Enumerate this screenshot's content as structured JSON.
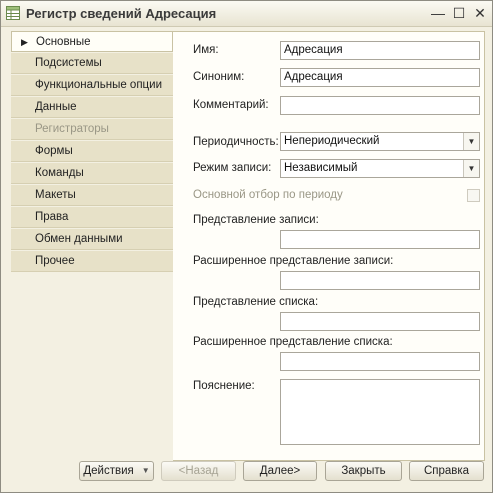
{
  "window": {
    "title": "Регистр сведений Адресация",
    "icon": "table-icon",
    "controls": {
      "minimize": "—",
      "maximize": "☐",
      "close": "✕"
    }
  },
  "nav": {
    "items": [
      {
        "label": "Основные",
        "state": "active"
      },
      {
        "label": "Подсистемы"
      },
      {
        "label": "Функциональные опции"
      },
      {
        "label": "Данные"
      },
      {
        "label": "Регистраторы",
        "state": "disabled"
      },
      {
        "label": "Формы"
      },
      {
        "label": "Команды"
      },
      {
        "label": "Макеты"
      },
      {
        "label": "Права"
      },
      {
        "label": "Обмен данными"
      },
      {
        "label": "Прочее"
      }
    ]
  },
  "form": {
    "name_label": "Имя:",
    "name_value": "Адресация",
    "synonym_label": "Синоним:",
    "synonym_value": "Адресация",
    "comment_label": "Комментарий:",
    "comment_value": "",
    "periodicity_label": "Периодичность:",
    "periodicity_value": "Непериодический",
    "write_mode_label": "Режим записи:",
    "write_mode_value": "Независимый",
    "period_filter_label": "Основной отбор по периоду",
    "record_repr_label": "Представление записи:",
    "record_repr_value": "",
    "ext_record_repr_label": "Расширенное представление записи:",
    "ext_record_repr_value": "",
    "list_repr_label": "Представление списка:",
    "list_repr_value": "",
    "ext_list_repr_label": "Расширенное представление списка:",
    "ext_list_repr_value": "",
    "explanation_label": "Пояснение:",
    "explanation_value": ""
  },
  "footer": {
    "actions": "Действия",
    "back": "<Назад",
    "next": "Далее>",
    "close": "Закрыть",
    "help": "Справка"
  }
}
